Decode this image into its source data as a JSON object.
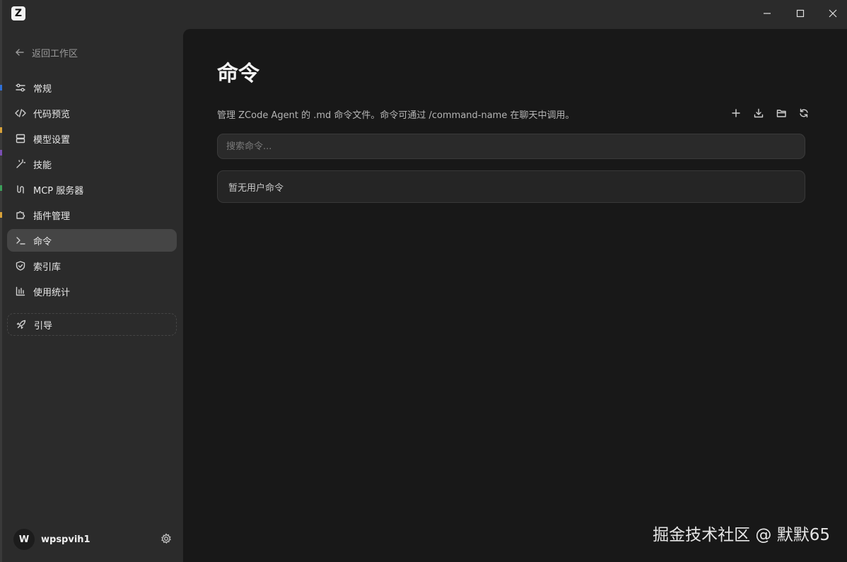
{
  "app": {
    "logo_letter": "Z"
  },
  "window_controls": {
    "minimize_icon": "minimize-icon",
    "maximize_icon": "maximize-icon",
    "close_icon": "close-icon"
  },
  "sidebar": {
    "back_label": "返回工作区",
    "items": [
      {
        "label": "常规",
        "icon": "sliders-icon"
      },
      {
        "label": "代码预览",
        "icon": "code-icon"
      },
      {
        "label": "模型设置",
        "icon": "server-icon"
      },
      {
        "label": "技能",
        "icon": "wand-icon"
      },
      {
        "label": "MCP 服务器",
        "icon": "mcp-icon"
      },
      {
        "label": "插件管理",
        "icon": "puzzle-icon"
      },
      {
        "label": "命令",
        "icon": "terminal-icon",
        "active": true
      },
      {
        "label": "索引库",
        "icon": "shield-icon"
      },
      {
        "label": "使用统计",
        "icon": "bar-chart-icon"
      }
    ],
    "guide_label": "引导",
    "user": {
      "avatar_letter": "W",
      "name": "wpspvih1"
    }
  },
  "main": {
    "title": "命令",
    "description": "管理 ZCode Agent 的 .md 命令文件。命令可通过 /command-name 在聊天中调用。",
    "toolbar": [
      "plus-icon",
      "download-icon",
      "folder-icon",
      "refresh-icon"
    ],
    "search_placeholder": "搜索命令...",
    "empty_text": "暂无用户命令"
  },
  "watermark": "掘金技术社区 @ 默默65",
  "colors": {
    "sidebar_bg": "#2b2b2b",
    "main_bg": "#181818",
    "active_item": "#454545"
  }
}
